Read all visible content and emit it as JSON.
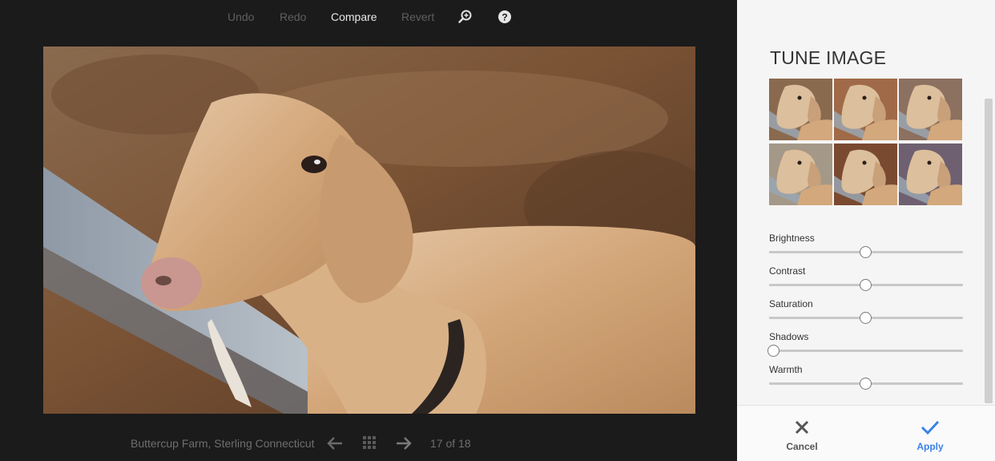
{
  "toolbar": {
    "undo": "Undo",
    "redo": "Redo",
    "compare": "Compare",
    "revert": "Revert",
    "zoom_icon": "zoom-in-icon",
    "help_icon": "help-icon"
  },
  "photo": {
    "subject": "goat"
  },
  "footer": {
    "caption": "Buttercup Farm, Sterling Connecticut",
    "counter": "17 of 18",
    "prev_icon": "arrow-left-icon",
    "grid_icon": "grid-icon",
    "next_icon": "arrow-right-icon"
  },
  "panel": {
    "title": "TUNE IMAGE",
    "presets_count": 6,
    "sliders": [
      {
        "label": "Brightness",
        "value": 0.5
      },
      {
        "label": "Contrast",
        "value": 0.5
      },
      {
        "label": "Saturation",
        "value": 0.5
      },
      {
        "label": "Shadows",
        "value": 0.02
      },
      {
        "label": "Warmth",
        "value": 0.5
      }
    ],
    "cancel": "Cancel",
    "apply": "Apply"
  },
  "colors": {
    "viewer_bg": "#1b1b1b",
    "panel_bg": "#f5f5f5",
    "accent": "#3b82e8",
    "cancel": "#555555"
  }
}
